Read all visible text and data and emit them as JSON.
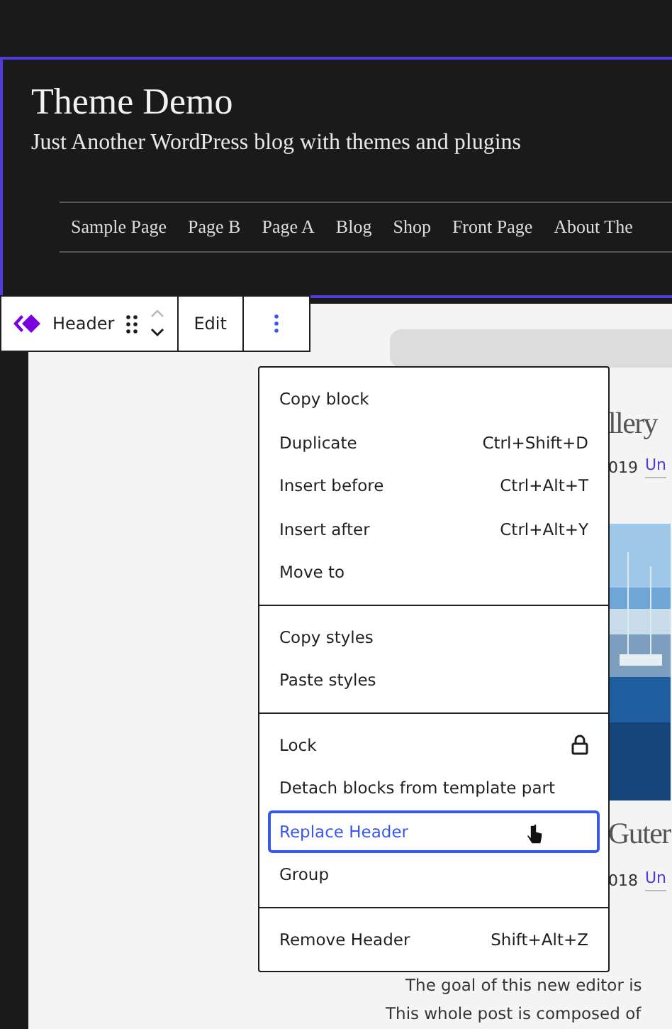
{
  "site": {
    "title": "Theme Demo",
    "tagline": "Just Another WordPress blog with themes and plugins"
  },
  "nav": [
    "Sample Page",
    "Page B",
    "Page A",
    "Blog",
    "Shop",
    "Front Page",
    "About The"
  ],
  "toolbar": {
    "block_label": "Header",
    "edit": "Edit"
  },
  "background_post": {
    "title_1": "llery",
    "meta_1": {
      "date": "019",
      "category": "Un"
    },
    "title_2": "Guter",
    "meta_2": {
      "date": "018",
      "category": "Un"
    },
    "paragraph": [
      "The goal of this new editor is",
      "This whole post is composed of"
    ]
  },
  "menu": {
    "sections": [
      {
        "items": [
          {
            "label": "Copy block",
            "kind": "plain",
            "selected": false
          },
          {
            "label": "Duplicate",
            "kind": "shortcut",
            "shortcut": "Ctrl+Shift+D",
            "selected": false
          },
          {
            "label": "Insert before",
            "kind": "shortcut",
            "shortcut": "Ctrl+Alt+T",
            "selected": false
          },
          {
            "label": "Insert after",
            "kind": "shortcut",
            "shortcut": "Ctrl+Alt+Y",
            "selected": false
          },
          {
            "label": "Move to",
            "kind": "plain",
            "selected": false
          }
        ]
      },
      {
        "items": [
          {
            "label": "Copy styles",
            "kind": "plain",
            "selected": false
          },
          {
            "label": "Paste styles",
            "kind": "plain",
            "selected": false
          }
        ]
      },
      {
        "items": [
          {
            "label": "Lock",
            "kind": "lock",
            "selected": false
          },
          {
            "label": "Detach blocks from template part",
            "kind": "plain",
            "selected": false
          },
          {
            "label": "Replace Header",
            "kind": "plain",
            "selected": true
          },
          {
            "label": "Group",
            "kind": "plain",
            "selected": false
          }
        ]
      },
      {
        "items": [
          {
            "label": "Remove Header",
            "kind": "shortcut",
            "shortcut": "Shift+Alt+Z",
            "selected": false
          }
        ]
      }
    ]
  }
}
